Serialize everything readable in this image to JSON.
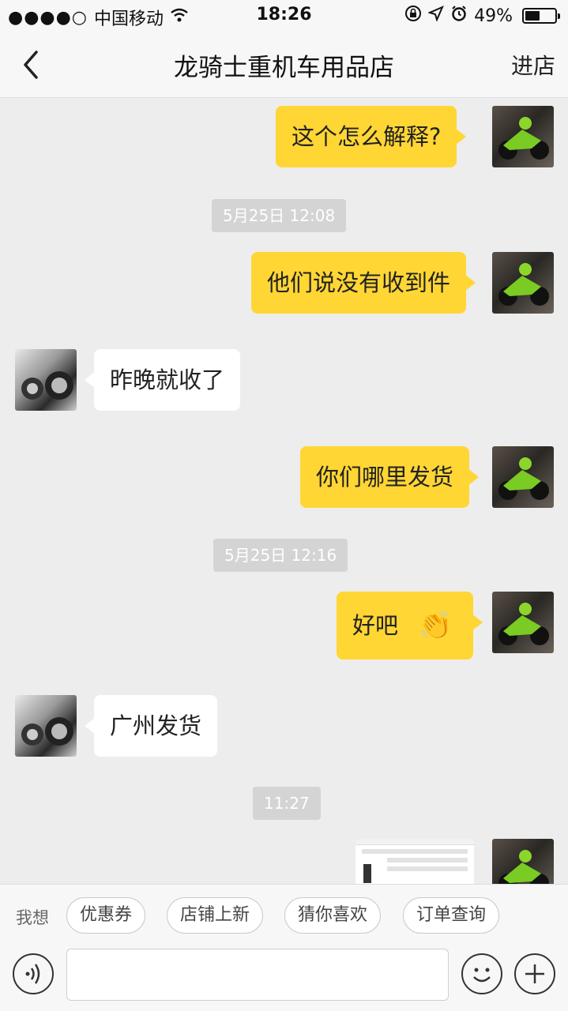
{
  "status": {
    "carrier": "中国移动",
    "time": "18:26",
    "battery": "49%",
    "battery_level": 0.49
  },
  "nav": {
    "title": "龙骑士重机车用品店",
    "right_action": "进店"
  },
  "messages": [
    {
      "type": "me",
      "text": "这个怎么解释?"
    },
    {
      "type": "time",
      "text": "5月25日 12:08"
    },
    {
      "type": "me",
      "text": "他们说没有收到件"
    },
    {
      "type": "them",
      "text": "昨晚就收了"
    },
    {
      "type": "me",
      "text": "你们哪里发货"
    },
    {
      "type": "time",
      "text": "5月25日 12:16"
    },
    {
      "type": "me",
      "text": "好吧",
      "emoji": "👏"
    },
    {
      "type": "them",
      "text": "广州发货"
    },
    {
      "type": "time",
      "text": "11:27"
    },
    {
      "type": "me-image",
      "text": ""
    }
  ],
  "quick": {
    "label": "我想",
    "options": [
      "优惠券",
      "店铺上新",
      "猜你喜欢",
      "订单查询"
    ]
  },
  "input": {
    "placeholder": ""
  },
  "colors": {
    "my_bubble": "#ffd634",
    "their_bubble": "#ffffff",
    "background": "#ededed"
  }
}
